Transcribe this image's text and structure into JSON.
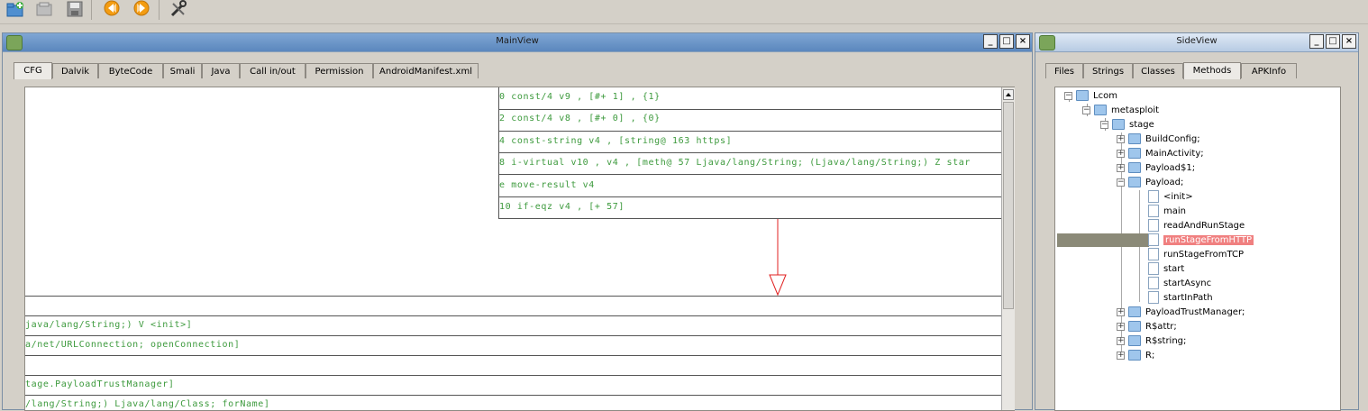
{
  "toolbar": {
    "icons": [
      "open-apk-icon",
      "close-icon",
      "save-icon",
      "back-icon",
      "forward-icon",
      "tools-icon"
    ]
  },
  "main_view": {
    "title": "MainView",
    "tabs": [
      "CFG",
      "Dalvik",
      "ByteCode",
      "Smali",
      "Java",
      "Call in/out",
      "Permission",
      "AndroidManifest.xml"
    ],
    "active_tab": "CFG",
    "upper_block": [
      "0 const/4 v9 , [#+ 1] , {1}",
      "2 const/4 v8 , [#+ 0] , {0}",
      "4 const-string v4 , [string@ 163 https]",
      "8 i-virtual v10 , v4 , [meth@ 57 Ljava/lang/String; (Ljava/lang/String;) Z star",
      "e move-result v4",
      "10 if-eqz v4 , [+ 57]"
    ],
    "lower_block": [
      "",
      "java/lang/String;) V <init>]",
      "a/net/URLConnection; openConnection]",
      "",
      "tage.PayloadTrustManager]",
      "/lang/String;) Ljava/lang/Class; forName]"
    ]
  },
  "side_view": {
    "title": "SideView",
    "tabs": [
      "Files",
      "Strings",
      "Classes",
      "Methods",
      "APKInfo"
    ],
    "active_tab": "Methods",
    "tree": {
      "root": "Lcom",
      "pkg1": "metasploit",
      "pkg2": "stage",
      "classes_a": [
        "BuildConfig;",
        "MainActivity;",
        "Payload$1;"
      ],
      "payload": "Payload;",
      "methods": [
        "<init>",
        "main",
        "readAndRunStage",
        "runStageFromHTTP",
        "runStageFromTCP",
        "start",
        "startAsync",
        "startInPath"
      ],
      "selected_method": "runStageFromHTTP",
      "classes_b": [
        "PayloadTrustManager;",
        "R$attr;",
        "R$string;",
        "R;"
      ]
    }
  }
}
